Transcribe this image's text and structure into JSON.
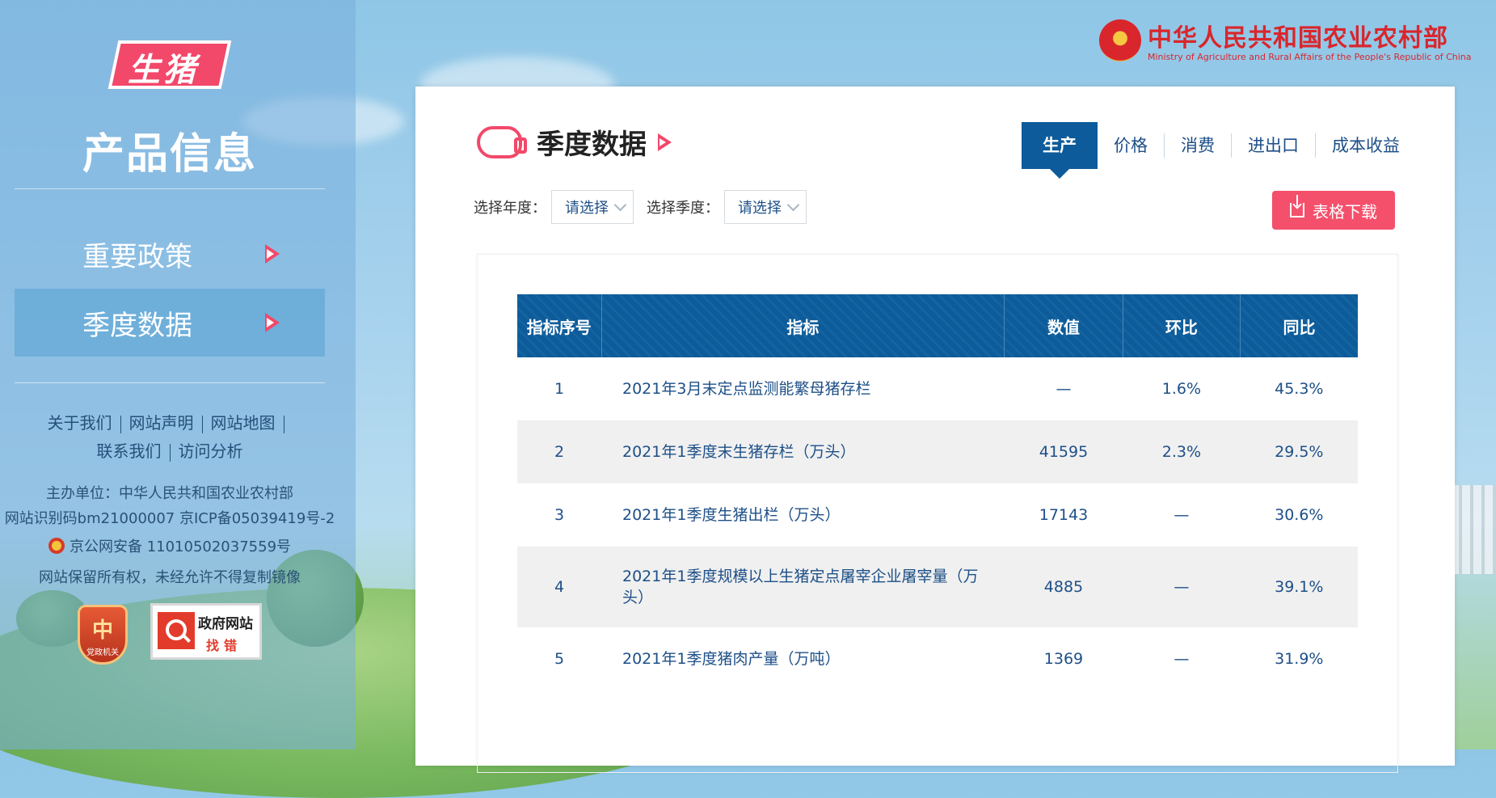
{
  "sidebar": {
    "brand": "生猪",
    "title": "产品信息",
    "menu": [
      {
        "label": "重要政策"
      },
      {
        "label": "季度数据"
      }
    ],
    "links_row1": [
      "关于我们",
      "网站声明",
      "网站地图"
    ],
    "links_row2": [
      "联系我们",
      "访问分析"
    ],
    "host": "主办单位：中华人民共和国农业农村部",
    "icp": "网站识别码bm21000007 京ICP备05039419号-2",
    "police": "京公网安备 11010502037559号",
    "copyright": "网站保留所有权，未经允许不得复制镜像",
    "badge1_big": "中",
    "badge1_small": "党政机关",
    "badge2_line1": "政府网站",
    "badge2_line2": "找错"
  },
  "ministry": {
    "cn": "中华人民共和国农业农村部",
    "en": "Ministry of Agriculture and Rural Affairs of the People's Republic of China"
  },
  "panel": {
    "title": "季度数据",
    "tabs": [
      "生产",
      "价格",
      "消费",
      "进出口",
      "成本收益"
    ],
    "active_tab": "生产",
    "year_label": "选择年度：",
    "year_value": "请选择",
    "quarter_label": "选择季度：",
    "quarter_value": "请选择",
    "download": "表格下载"
  },
  "table": {
    "headers": [
      "指标序号",
      "指标",
      "数值",
      "环比",
      "同比"
    ],
    "rows": [
      [
        "1",
        "2021年3月末定点监测能繁母猪存栏",
        "—",
        "1.6%",
        "45.3%"
      ],
      [
        "2",
        "2021年1季度末生猪存栏（万头）",
        "41595",
        "2.3%",
        "29.5%"
      ],
      [
        "3",
        "2021年1季度生猪出栏（万头）",
        "17143",
        "—",
        "30.6%"
      ],
      [
        "4",
        "2021年1季度规模以上生猪定点屠宰企业屠宰量（万头）",
        "4885",
        "—",
        "39.1%"
      ],
      [
        "5",
        "2021年1季度猪肉产量（万吨）",
        "1369",
        "—",
        "31.9%"
      ]
    ]
  },
  "colors": {
    "accent": "#f2486a",
    "primary": "#0d5b9a",
    "text_blue": "#1d4f87"
  }
}
